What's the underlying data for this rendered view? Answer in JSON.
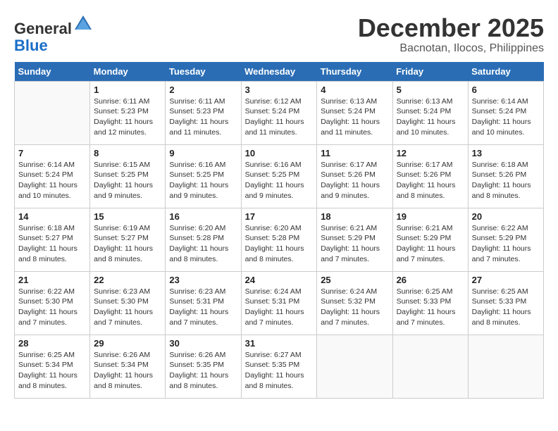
{
  "header": {
    "logo_line1": "General",
    "logo_line2": "Blue",
    "month_year": "December 2025",
    "location": "Bacnotan, Ilocos, Philippines"
  },
  "weekdays": [
    "Sunday",
    "Monday",
    "Tuesday",
    "Wednesday",
    "Thursday",
    "Friday",
    "Saturday"
  ],
  "weeks": [
    [
      {
        "day": "",
        "info": ""
      },
      {
        "day": "1",
        "info": "Sunrise: 6:11 AM\nSunset: 5:23 PM\nDaylight: 11 hours and 12 minutes."
      },
      {
        "day": "2",
        "info": "Sunrise: 6:11 AM\nSunset: 5:23 PM\nDaylight: 11 hours and 11 minutes."
      },
      {
        "day": "3",
        "info": "Sunrise: 6:12 AM\nSunset: 5:24 PM\nDaylight: 11 hours and 11 minutes."
      },
      {
        "day": "4",
        "info": "Sunrise: 6:13 AM\nSunset: 5:24 PM\nDaylight: 11 hours and 11 minutes."
      },
      {
        "day": "5",
        "info": "Sunrise: 6:13 AM\nSunset: 5:24 PM\nDaylight: 11 hours and 10 minutes."
      },
      {
        "day": "6",
        "info": "Sunrise: 6:14 AM\nSunset: 5:24 PM\nDaylight: 11 hours and 10 minutes."
      }
    ],
    [
      {
        "day": "7",
        "info": "Sunrise: 6:14 AM\nSunset: 5:24 PM\nDaylight: 11 hours and 10 minutes."
      },
      {
        "day": "8",
        "info": "Sunrise: 6:15 AM\nSunset: 5:25 PM\nDaylight: 11 hours and 9 minutes."
      },
      {
        "day": "9",
        "info": "Sunrise: 6:16 AM\nSunset: 5:25 PM\nDaylight: 11 hours and 9 minutes."
      },
      {
        "day": "10",
        "info": "Sunrise: 6:16 AM\nSunset: 5:25 PM\nDaylight: 11 hours and 9 minutes."
      },
      {
        "day": "11",
        "info": "Sunrise: 6:17 AM\nSunset: 5:26 PM\nDaylight: 11 hours and 9 minutes."
      },
      {
        "day": "12",
        "info": "Sunrise: 6:17 AM\nSunset: 5:26 PM\nDaylight: 11 hours and 8 minutes."
      },
      {
        "day": "13",
        "info": "Sunrise: 6:18 AM\nSunset: 5:26 PM\nDaylight: 11 hours and 8 minutes."
      }
    ],
    [
      {
        "day": "14",
        "info": "Sunrise: 6:18 AM\nSunset: 5:27 PM\nDaylight: 11 hours and 8 minutes."
      },
      {
        "day": "15",
        "info": "Sunrise: 6:19 AM\nSunset: 5:27 PM\nDaylight: 11 hours and 8 minutes."
      },
      {
        "day": "16",
        "info": "Sunrise: 6:20 AM\nSunset: 5:28 PM\nDaylight: 11 hours and 8 minutes."
      },
      {
        "day": "17",
        "info": "Sunrise: 6:20 AM\nSunset: 5:28 PM\nDaylight: 11 hours and 8 minutes."
      },
      {
        "day": "18",
        "info": "Sunrise: 6:21 AM\nSunset: 5:29 PM\nDaylight: 11 hours and 7 minutes."
      },
      {
        "day": "19",
        "info": "Sunrise: 6:21 AM\nSunset: 5:29 PM\nDaylight: 11 hours and 7 minutes."
      },
      {
        "day": "20",
        "info": "Sunrise: 6:22 AM\nSunset: 5:29 PM\nDaylight: 11 hours and 7 minutes."
      }
    ],
    [
      {
        "day": "21",
        "info": "Sunrise: 6:22 AM\nSunset: 5:30 PM\nDaylight: 11 hours and 7 minutes."
      },
      {
        "day": "22",
        "info": "Sunrise: 6:23 AM\nSunset: 5:30 PM\nDaylight: 11 hours and 7 minutes."
      },
      {
        "day": "23",
        "info": "Sunrise: 6:23 AM\nSunset: 5:31 PM\nDaylight: 11 hours and 7 minutes."
      },
      {
        "day": "24",
        "info": "Sunrise: 6:24 AM\nSunset: 5:31 PM\nDaylight: 11 hours and 7 minutes."
      },
      {
        "day": "25",
        "info": "Sunrise: 6:24 AM\nSunset: 5:32 PM\nDaylight: 11 hours and 7 minutes."
      },
      {
        "day": "26",
        "info": "Sunrise: 6:25 AM\nSunset: 5:33 PM\nDaylight: 11 hours and 7 minutes."
      },
      {
        "day": "27",
        "info": "Sunrise: 6:25 AM\nSunset: 5:33 PM\nDaylight: 11 hours and 8 minutes."
      }
    ],
    [
      {
        "day": "28",
        "info": "Sunrise: 6:25 AM\nSunset: 5:34 PM\nDaylight: 11 hours and 8 minutes."
      },
      {
        "day": "29",
        "info": "Sunrise: 6:26 AM\nSunset: 5:34 PM\nDaylight: 11 hours and 8 minutes."
      },
      {
        "day": "30",
        "info": "Sunrise: 6:26 AM\nSunset: 5:35 PM\nDaylight: 11 hours and 8 minutes."
      },
      {
        "day": "31",
        "info": "Sunrise: 6:27 AM\nSunset: 5:35 PM\nDaylight: 11 hours and 8 minutes."
      },
      {
        "day": "",
        "info": ""
      },
      {
        "day": "",
        "info": ""
      },
      {
        "day": "",
        "info": ""
      }
    ]
  ]
}
